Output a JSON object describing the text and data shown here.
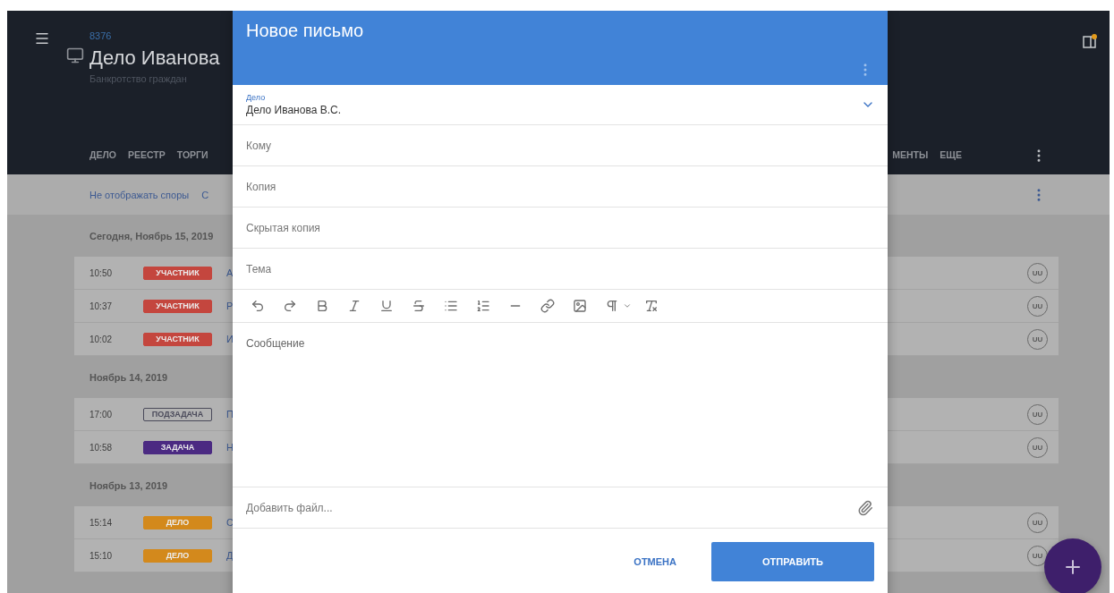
{
  "app": {
    "case_number": "8376",
    "title": "Дело Иванова",
    "subtitle": "Банкротство граждан",
    "tabs_left": [
      {
        "label": "ДЕЛО",
        "selected": false
      },
      {
        "label": "РЕЕСТР",
        "selected": false
      },
      {
        "label": "ТОРГИ",
        "selected": false
      }
    ],
    "tabs_right": [
      {
        "label": "МЕНТЫ",
        "selected": false
      },
      {
        "label": "ЕЩЕ",
        "selected": false
      }
    ]
  },
  "filter_bar": {
    "links": [
      "Не отображать споры",
      "С"
    ]
  },
  "timeline": [
    {
      "date": "Сегодня, Ноябрь 15, 2019",
      "events": [
        {
          "time": "10:50",
          "badge": {
            "label": "УЧАСТНИК",
            "kind": "filled",
            "color": "#c4463e"
          },
          "text": "А",
          "avatar": "UU"
        },
        {
          "time": "10:37",
          "badge": {
            "label": "УЧАСТНИК",
            "kind": "filled",
            "color": "#c4463e"
          },
          "text": "Р",
          "avatar": "UU"
        },
        {
          "time": "10:02",
          "badge": {
            "label": "УЧАСТНИК",
            "kind": "filled",
            "color": "#c4463e"
          },
          "text": "И",
          "avatar": "UU"
        }
      ]
    },
    {
      "date": "Ноябрь 14, 2019",
      "events": [
        {
          "time": "17:00",
          "badge": {
            "label": "ПОДЗАДАЧА",
            "kind": "outline",
            "color": "#4a4a5a"
          },
          "text": "П",
          "avatar": "UU"
        },
        {
          "time": "10:58",
          "badge": {
            "label": "ЗАДАЧА",
            "kind": "filled",
            "color": "#4b2a82"
          },
          "text": "Н",
          "avatar": "UU"
        }
      ]
    },
    {
      "date": "Ноябрь 13, 2019",
      "events": [
        {
          "time": "15:14",
          "badge": {
            "label": "ДЕЛО",
            "kind": "filled",
            "color": "#d3891c"
          },
          "text": "С",
          "avatar": "UU"
        },
        {
          "time": "15:10",
          "badge": {
            "label": "ДЕЛО",
            "kind": "filled",
            "color": "#d3891c"
          },
          "text": "Д",
          "avatar": "UU"
        }
      ]
    }
  ],
  "dialog": {
    "title": "Новое письмо",
    "fields": [
      {
        "kind": "select",
        "label": "Дело",
        "value": "Дело Иванова В.С."
      },
      {
        "kind": "input",
        "placeholder": "Кому"
      },
      {
        "kind": "input",
        "placeholder": "Копия"
      },
      {
        "kind": "input",
        "placeholder": "Скрытая копия"
      },
      {
        "kind": "input",
        "placeholder": "Тема"
      }
    ],
    "message_placeholder": "Сообщение",
    "attach_label": "Добавить файл...",
    "cancel": "ОТМЕНА",
    "send": "ОТПРАВИТЬ"
  }
}
